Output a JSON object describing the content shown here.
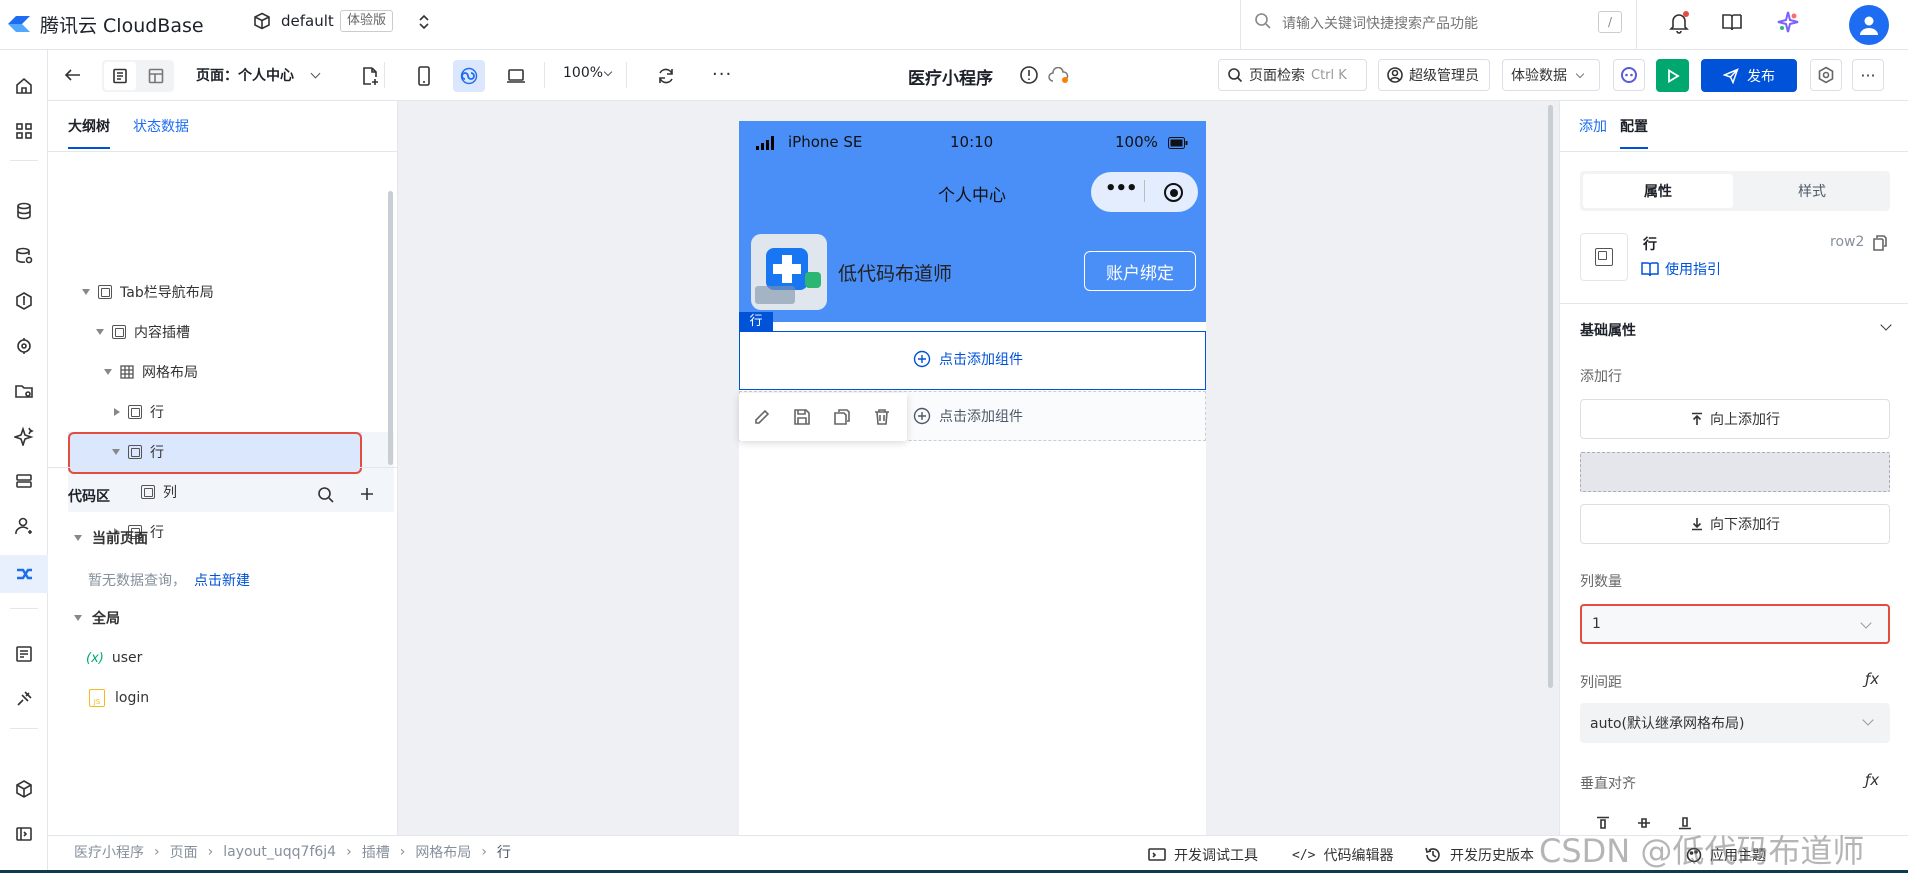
{
  "header": {
    "brand": "腾讯云 CloudBase",
    "env_name": "default",
    "env_badge": "体验版",
    "search_placeholder": "请输入关键词快捷搜索产品功能",
    "search_shortcut": "/"
  },
  "toolbar": {
    "page_label": "页面：个人中心",
    "zoom": "100%",
    "app_title": "医疗小程序",
    "page_search": "页面检索",
    "page_search_shortcut": "Ctrl K",
    "role": "超级管理员",
    "data_mode": "体验数据",
    "publish": "发布"
  },
  "outline": {
    "tabs": [
      "大纲树",
      "状态数据"
    ],
    "nodes": [
      {
        "label": "Tab栏导航布局"
      },
      {
        "label": "内容插槽"
      },
      {
        "label": "网格布局"
      },
      {
        "label": "行"
      },
      {
        "label": "行"
      },
      {
        "label": "列"
      },
      {
        "label": "行"
      }
    ]
  },
  "code": {
    "title": "代码区",
    "current_page": "当前页面",
    "empty_text": "暂无数据查询，",
    "create_link": "点击新建",
    "global": "全局",
    "items": [
      {
        "icon": "(x)",
        "label": "user"
      },
      {
        "icon": "JS",
        "label": "login"
      }
    ]
  },
  "phone": {
    "carrier": "iPhone SE",
    "time": "10:10",
    "battery": "100%",
    "title": "个人中心",
    "user_name": "低代码布道师",
    "bind_button": "账户绑定",
    "row_tag": "行",
    "add_component": "点击添加组件",
    "add_component2": "点击添加组件"
  },
  "right": {
    "tabs": [
      "添加",
      "配置"
    ],
    "subtabs": [
      "属性",
      "样式"
    ],
    "component_name": "行",
    "component_id": "row2",
    "guide": "使用指引",
    "section": "基础属性",
    "add_row_label": "添加行",
    "add_above": "向上添加行",
    "add_below": "向下添加行",
    "col_count_label": "列数量",
    "col_count": "1",
    "col_gap_label": "列间距",
    "col_gap": "auto(默认继承网格布局)",
    "valign_label": "垂直对齐",
    "fx": "ƒx"
  },
  "footer": {
    "breadcrumb": [
      "医疗小程序",
      "页面",
      "layout_uqq7f6j4",
      "插槽",
      "网格布局",
      "行"
    ],
    "devtools": "开发调试工具",
    "code_editor": "代码编辑器",
    "history": "开发历史版本",
    "theme": "应用主题",
    "watermark": "CSDN @低代码布道师"
  },
  "colors": {
    "accent": "#0052d9",
    "phone_blue": "#4a8ff7",
    "selection_red": "#e34d3e",
    "publish_green": "#00a870"
  }
}
